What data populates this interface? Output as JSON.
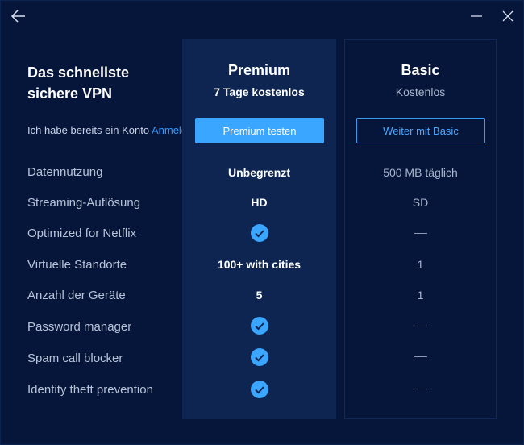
{
  "hero": {
    "title_line1": "Das schnellste",
    "title_line2": "sichere VPN",
    "login_text": "Ich habe bereits ein Konto",
    "login_link": "Anmelden"
  },
  "plans": {
    "premium": {
      "name": "Premium",
      "subtitle": "7 Tage kostenlos",
      "button": "Premium testen"
    },
    "basic": {
      "name": "Basic",
      "subtitle": "Kostenlos",
      "button": "Weiter mit Basic"
    }
  },
  "features": [
    {
      "label": "Datennutzung",
      "premium": "Unbegrenzt",
      "basic": "500 MB täglich"
    },
    {
      "label": "Streaming-Auflösung",
      "premium": "HD",
      "basic": "SD"
    },
    {
      "label": "Optimized for Netflix",
      "premium_icon": "check-icon",
      "basic_icon": "dash-icon"
    },
    {
      "label": "Virtuelle Standorte",
      "premium": "100+ with cities",
      "basic": "1"
    },
    {
      "label": "Anzahl der Geräte",
      "premium": "5",
      "basic": "1"
    },
    {
      "label": "Password manager",
      "premium_icon": "check-icon",
      "basic_icon": "dash-icon"
    },
    {
      "label": "Spam call blocker",
      "premium_icon": "check-icon",
      "basic_icon": "dash-icon"
    },
    {
      "label": "Identity theft prevention",
      "premium_icon": "check-icon",
      "basic_icon": "dash-icon"
    }
  ],
  "titlebar": {
    "back_icon": "arrow-left-icon",
    "minimize_icon": "minimize-icon",
    "close_icon": "close-icon"
  },
  "colors": {
    "background": "#06163a",
    "premium_column": "#0d2550",
    "accent": "#3aa6ff",
    "check": "#3aa6ff"
  }
}
